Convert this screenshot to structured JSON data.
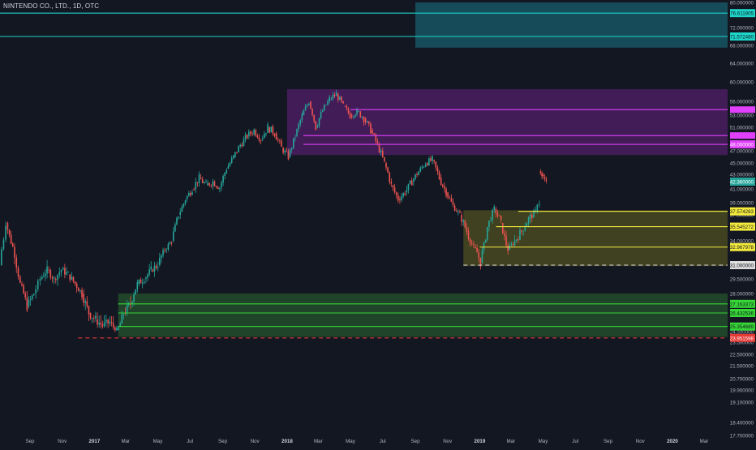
{
  "header": {
    "title": "NINTENDO CO., LTD., 1D, OTC"
  },
  "chart_data": {
    "type": "candlestick",
    "title": "NINTENDO CO., LTD., 1D, OTC",
    "grid": false,
    "y_axis": {
      "position": "right",
      "ticks": [
        17.7,
        18.4,
        19.1,
        19.9,
        20.7,
        21.5,
        22.5,
        23.5,
        24.5,
        25.5,
        28.0,
        29.5,
        31.0,
        32.0,
        34.0,
        35.0,
        37.0,
        39.0,
        41.0,
        43.0,
        45.0,
        47.0,
        51.0,
        53.0,
        56.0,
        60.0,
        64.0,
        68.0,
        72.0,
        80.0
      ],
      "tick_labels": [
        "17.700000",
        "18.400000",
        "19.100000",
        "19.900000",
        "20.700000",
        "21.500000",
        "22.500000",
        "23.500000",
        "24.500000",
        "",
        "28.000000",
        "29.500000",
        "",
        "",
        "34.000000",
        "",
        "37.000000",
        "39.000000",
        "41.000000",
        "43.000000",
        "45.000000",
        "47.000000",
        "51.000000",
        "53.000000",
        "56.000000",
        "60.000000",
        "64.000000",
        "68.000000",
        "72.000000",
        "80.000000"
      ]
    },
    "x_axis": {
      "ticks": [
        {
          "label": "Sep",
          "date": "2016-09-01"
        },
        {
          "label": "Nov",
          "date": "2016-11-01"
        },
        {
          "label": "2017",
          "date": "2017-01-01"
        },
        {
          "label": "Mar",
          "date": "2017-03-01"
        },
        {
          "label": "May",
          "date": "2017-05-01"
        },
        {
          "label": "Jul",
          "date": "2017-07-01"
        },
        {
          "label": "Sep",
          "date": "2017-09-01"
        },
        {
          "label": "Nov",
          "date": "2017-11-01"
        },
        {
          "label": "2018",
          "date": "2018-01-01"
        },
        {
          "label": "Mar",
          "date": "2018-03-01"
        },
        {
          "label": "May",
          "date": "2018-05-01"
        },
        {
          "label": "Jul",
          "date": "2018-07-01"
        },
        {
          "label": "Sep",
          "date": "2018-09-01"
        },
        {
          "label": "Nov",
          "date": "2018-11-01"
        },
        {
          "label": "2019",
          "date": "2019-01-01"
        },
        {
          "label": "Mar",
          "date": "2019-03-01"
        },
        {
          "label": "May",
          "date": "2019-05-01"
        },
        {
          "label": "Jul",
          "date": "2019-07-01"
        },
        {
          "label": "Sep",
          "date": "2019-09-01"
        },
        {
          "label": "Nov",
          "date": "2019-11-01"
        },
        {
          "label": "2020",
          "date": "2020-01-01"
        },
        {
          "label": "Mar",
          "date": "2020-03-01"
        }
      ]
    },
    "colors": {
      "up": "#26a69a",
      "down": "#ef5350",
      "background": "#131722",
      "text": "#b2b5be"
    },
    "zones": [
      {
        "name": "teal-zone",
        "date_start": "2018-09-01",
        "date_end": "2020-04-30",
        "y_low": 67.5,
        "y_high": 80.0,
        "color": "#1ea0b4",
        "opacity": 0.38
      },
      {
        "name": "purple-zone",
        "date_start": "2018-01-01",
        "date_end": "2020-04-30",
        "y_low": 46.3,
        "y_high": 58.5,
        "color": "#8e24aa",
        "opacity": 0.38
      },
      {
        "name": "yellow-zone",
        "date_start": "2018-12-01",
        "date_end": "2020-04-30",
        "y_low": 30.9,
        "y_high": 37.75,
        "color": "#7b7b1e",
        "opacity": 0.42
      },
      {
        "name": "green-zone",
        "date_start": "2017-02-15",
        "date_end": "2020-04-30",
        "y_low": 24.0,
        "y_high": 28.0,
        "color": "#2e7d32",
        "opacity": 0.45
      }
    ],
    "levels": [
      {
        "y": 76.6,
        "label": "76.611905",
        "date_start": "2016-06-15",
        "color": "#1dd4c8",
        "style": "solid"
      },
      {
        "y": 70.0,
        "label": "71.572480",
        "date_start": "2016-06-15",
        "color": "#1dd4c8",
        "style": "solid"
      },
      {
        "y": 54.2,
        "label": "",
        "date_start": "2018-05-01",
        "color": "#e040fb",
        "style": "solid"
      },
      {
        "y": 49.6,
        "label": "",
        "date_start": "2018-02-01",
        "color": "#e040fb",
        "style": "solid"
      },
      {
        "y": 48.1,
        "label": "48.000000",
        "date_start": "2018-02-01",
        "color": "#e040fb",
        "style": "solid"
      },
      {
        "y": 37.5742,
        "label": "37.574283",
        "date_start": "2019-03-15",
        "color": "#f5eb3c",
        "style": "solid"
      },
      {
        "y": 35.5452,
        "label": "35.545272",
        "date_start": "2019-02-01",
        "color": "#f5eb3c",
        "style": "solid"
      },
      {
        "y": 32.9679,
        "label": "32.967978",
        "date_start": "2019-01-01",
        "color": "#f5eb3c",
        "style": "solid"
      },
      {
        "y": 31.0,
        "label": "31.000000",
        "date_start": "2018-12-01",
        "color": "#dddddd",
        "style": "dashed"
      },
      {
        "y": 27.2,
        "label": "27.163373",
        "date_start": "2017-02-15",
        "color": "#36d636",
        "style": "solid"
      },
      {
        "y": 26.5,
        "label": "26.432536",
        "date_start": "2017-02-15",
        "color": "#36d636",
        "style": "solid"
      },
      {
        "y": 25.4,
        "label": "25.354689",
        "date_start": "2017-02-15",
        "color": "#36d636",
        "style": "solid"
      },
      {
        "y": 23.9,
        "label": "23.951598",
        "date_start": "2016-12-01",
        "color": "#e53935",
        "style": "dashed"
      }
    ],
    "price_label": {
      "y": 42.0,
      "label": "42.360000",
      "color": "#26a69a"
    },
    "series": [
      {
        "date": "2016-07-07",
        "o": 31.0,
        "c": 36.0
      },
      {
        "date": "2016-07-19",
        "o": 36.0,
        "c": 33.0
      },
      {
        "date": "2016-08-01",
        "o": 33.0,
        "c": 29.0
      },
      {
        "date": "2016-08-15",
        "o": 29.0,
        "c": 27.0
      },
      {
        "date": "2016-08-28",
        "o": 27.0,
        "c": 28.0
      },
      {
        "date": "2016-09-10",
        "o": 28.0,
        "c": 29.5
      },
      {
        "date": "2016-09-22",
        "o": 29.5,
        "c": 30.5
      },
      {
        "date": "2016-10-05",
        "o": 30.5,
        "c": 29.5
      },
      {
        "date": "2016-10-18",
        "o": 29.5,
        "c": 30.5
      },
      {
        "date": "2016-11-01",
        "o": 30.5,
        "c": 30.0
      },
      {
        "date": "2016-11-14",
        "o": 30.0,
        "c": 29.0
      },
      {
        "date": "2016-11-27",
        "o": 29.0,
        "c": 28.0
      },
      {
        "date": "2016-12-10",
        "o": 28.0,
        "c": 26.5
      },
      {
        "date": "2016-12-23",
        "o": 26.5,
        "c": 26.0
      },
      {
        "date": "2017-01-05",
        "o": 26.0,
        "c": 25.5
      },
      {
        "date": "2017-01-18",
        "o": 25.5,
        "c": 25.8
      },
      {
        "date": "2017-02-01",
        "o": 25.8,
        "c": 24.8
      },
      {
        "date": "2017-02-14",
        "o": 24.8,
        "c": 26.5
      },
      {
        "date": "2017-02-27",
        "o": 26.5,
        "c": 27.2
      },
      {
        "date": "2017-03-12",
        "o": 27.2,
        "c": 29.0
      },
      {
        "date": "2017-03-25",
        "o": 29.0,
        "c": 29.5
      },
      {
        "date": "2017-04-07",
        "o": 29.5,
        "c": 30.5
      },
      {
        "date": "2017-04-20",
        "o": 30.5,
        "c": 31.0
      },
      {
        "date": "2017-05-03",
        "o": 31.0,
        "c": 32.5
      },
      {
        "date": "2017-05-16",
        "o": 32.5,
        "c": 34.0
      },
      {
        "date": "2017-05-29",
        "o": 34.0,
        "c": 37.0
      },
      {
        "date": "2017-06-11",
        "o": 37.0,
        "c": 39.5
      },
      {
        "date": "2017-06-24",
        "o": 39.5,
        "c": 41.0
      },
      {
        "date": "2017-07-07",
        "o": 41.0,
        "c": 42.5
      },
      {
        "date": "2017-07-20",
        "o": 42.5,
        "c": 41.5
      },
      {
        "date": "2017-08-02",
        "o": 41.5,
        "c": 42.0
      },
      {
        "date": "2017-08-15",
        "o": 42.0,
        "c": 41.2
      },
      {
        "date": "2017-08-28",
        "o": 41.2,
        "c": 44.0
      },
      {
        "date": "2017-09-10",
        "o": 44.0,
        "c": 46.0
      },
      {
        "date": "2017-09-23",
        "o": 46.0,
        "c": 48.0
      },
      {
        "date": "2017-10-06",
        "o": 48.0,
        "c": 49.5
      },
      {
        "date": "2017-10-19",
        "o": 49.5,
        "c": 50.5
      },
      {
        "date": "2017-11-01",
        "o": 50.5,
        "c": 49.0
      },
      {
        "date": "2017-11-14",
        "o": 49.0,
        "c": 51.0
      },
      {
        "date": "2017-11-27",
        "o": 51.0,
        "c": 50.0
      },
      {
        "date": "2017-12-10",
        "o": 50.0,
        "c": 47.5
      },
      {
        "date": "2017-12-23",
        "o": 47.5,
        "c": 46.0
      },
      {
        "date": "2018-01-05",
        "o": 46.0,
        "c": 49.5
      },
      {
        "date": "2018-01-18",
        "o": 49.5,
        "c": 53.0
      },
      {
        "date": "2018-01-31",
        "o": 53.0,
        "c": 56.0
      },
      {
        "date": "2018-02-13",
        "o": 56.0,
        "c": 51.0
      },
      {
        "date": "2018-02-26",
        "o": 51.0,
        "c": 54.0
      },
      {
        "date": "2018-03-11",
        "o": 54.0,
        "c": 56.5
      },
      {
        "date": "2018-03-24",
        "o": 56.5,
        "c": 57.5
      },
      {
        "date": "2018-04-06",
        "o": 57.5,
        "c": 55.0
      },
      {
        "date": "2018-04-19",
        "o": 55.0,
        "c": 53.0
      },
      {
        "date": "2018-05-02",
        "o": 53.0,
        "c": 53.8
      },
      {
        "date": "2018-05-15",
        "o": 53.8,
        "c": 52.5
      },
      {
        "date": "2018-05-28",
        "o": 52.5,
        "c": 50.5
      },
      {
        "date": "2018-06-10",
        "o": 50.5,
        "c": 48.0
      },
      {
        "date": "2018-06-23",
        "o": 48.0,
        "c": 45.0
      },
      {
        "date": "2018-07-06",
        "o": 45.0,
        "c": 41.5
      },
      {
        "date": "2018-07-19",
        "o": 41.5,
        "c": 39.5
      },
      {
        "date": "2018-08-01",
        "o": 39.5,
        "c": 40.5
      },
      {
        "date": "2018-08-14",
        "o": 40.5,
        "c": 42.0
      },
      {
        "date": "2018-08-27",
        "o": 42.0,
        "c": 43.5
      },
      {
        "date": "2018-09-09",
        "o": 43.5,
        "c": 45.0
      },
      {
        "date": "2018-09-22",
        "o": 45.0,
        "c": 45.5
      },
      {
        "date": "2018-10-05",
        "o": 45.5,
        "c": 42.5
      },
      {
        "date": "2018-10-18",
        "o": 42.5,
        "c": 40.5
      },
      {
        "date": "2018-10-31",
        "o": 40.5,
        "c": 38.5
      },
      {
        "date": "2018-11-13",
        "o": 38.5,
        "c": 37.0
      },
      {
        "date": "2018-11-26",
        "o": 37.0,
        "c": 35.0
      },
      {
        "date": "2018-12-09",
        "o": 35.0,
        "c": 33.0
      },
      {
        "date": "2018-12-22",
        "o": 33.0,
        "c": 31.2
      },
      {
        "date": "2019-01-04",
        "o": 31.2,
        "c": 35.5
      },
      {
        "date": "2019-01-17",
        "o": 35.5,
        "c": 38.0
      },
      {
        "date": "2019-01-30",
        "o": 38.0,
        "c": 36.0
      },
      {
        "date": "2019-02-12",
        "o": 36.0,
        "c": 32.5
      },
      {
        "date": "2019-02-25",
        "o": 32.5,
        "c": 34.0
      },
      {
        "date": "2019-03-10",
        "o": 34.0,
        "c": 35.0
      },
      {
        "date": "2019-03-23",
        "o": 35.0,
        "c": 36.5
      },
      {
        "date": "2019-04-05",
        "o": 36.5,
        "c": 37.5
      },
      {
        "date": "2019-04-18",
        "o": 37.5,
        "c": 39.0
      },
      {
        "date": "2019-04-26",
        "o": 43.5,
        "c": 42.2
      }
    ]
  }
}
